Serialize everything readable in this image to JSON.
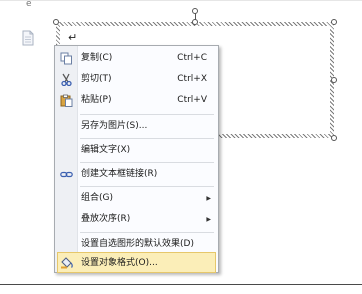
{
  "document": {
    "top_fragment": "e",
    "paragraph_mark": "↵"
  },
  "context_menu": {
    "items": [
      {
        "id": "copy",
        "label": "复制(C)",
        "shortcut": "Ctrl+C",
        "icon": "copy-icon"
      },
      {
        "id": "cut",
        "label": "剪切(T)",
        "shortcut": "Ctrl+X",
        "icon": "scissors-icon"
      },
      {
        "id": "paste",
        "label": "粘贴(P)",
        "shortcut": "Ctrl+V",
        "icon": "paste-icon"
      },
      {
        "id": "save-as-picture",
        "label": "另存为图片(S)..."
      },
      {
        "id": "edit-text",
        "label": "编辑文字(X)"
      },
      {
        "id": "create-textbox-link",
        "label": "创建文本框链接(R)",
        "icon": "chain-link-icon"
      },
      {
        "id": "group",
        "label": "组合(G)",
        "submenu": true
      },
      {
        "id": "order",
        "label": "叠放次序(R)",
        "submenu": true
      },
      {
        "id": "set-default-effect",
        "label": "设置自选图形的默认效果(D)"
      },
      {
        "id": "format-object",
        "label": "设置对象格式(O)...",
        "icon": "paint-bucket-icon",
        "highlighted": true
      }
    ],
    "submenu_arrow": "▶",
    "colors": {
      "highlight_background": "#fbeeb8",
      "highlight_border": "#e6c76a",
      "menu_background": "#fbfcff",
      "icon_column": "#eef0f4"
    }
  }
}
